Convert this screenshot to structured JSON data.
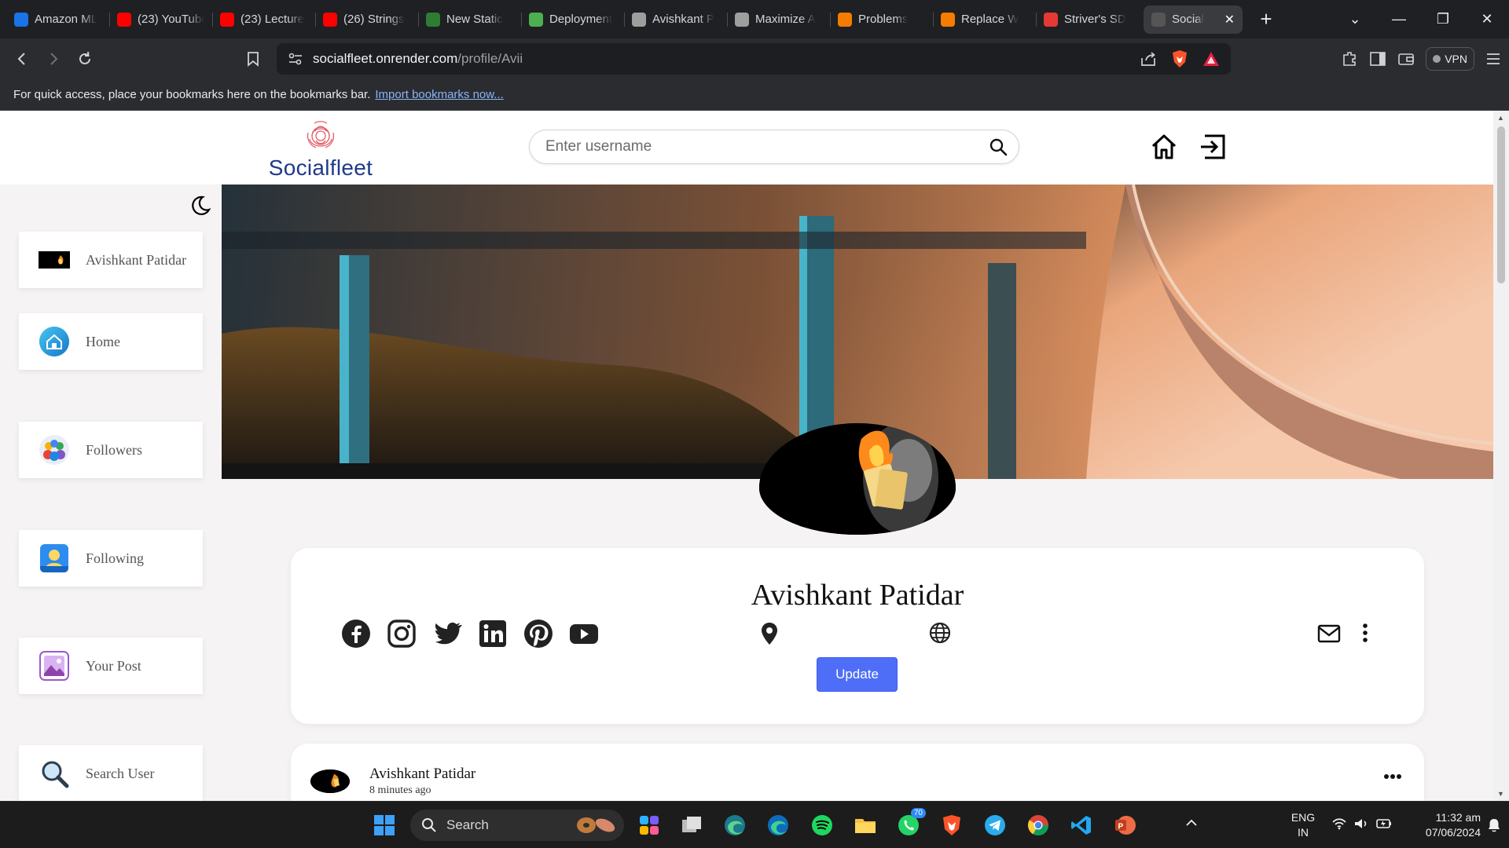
{
  "browser": {
    "tabs": [
      {
        "label": "Amazon ML",
        "color": "#1a73e8"
      },
      {
        "label": "(23) YouTube",
        "color": "#ff0000"
      },
      {
        "label": "(23) Lecture",
        "color": "#ff0000"
      },
      {
        "label": "(26) Strings",
        "color": "#ff0000"
      },
      {
        "label": "New Static",
        "color": "#2e7d32"
      },
      {
        "label": "Deployment",
        "color": "#4caf50"
      },
      {
        "label": "Avishkant P",
        "color": "#9e9e9e"
      },
      {
        "label": "Maximize A",
        "color": "#9e9e9e"
      },
      {
        "label": "Problems",
        "color": "#f57c00"
      },
      {
        "label": "Replace W",
        "color": "#f57c00"
      },
      {
        "label": "Striver's SD",
        "color": "#e53935"
      },
      {
        "label": "Social",
        "color": "#555555",
        "active": true
      }
    ],
    "url_host": "socialfleet.onrender.com",
    "url_path": "/profile/Avii",
    "vpn_label": "VPN",
    "bookmarks_text": "For quick access, place your bookmarks here on the bookmarks bar.",
    "bookmarks_link": "Import bookmarks now..."
  },
  "site": {
    "brand": "Socialfleet",
    "search_placeholder": "Enter username",
    "accent_color": "#4f6ef7"
  },
  "sidebar": {
    "items": [
      {
        "label": "Avishkant Patidar",
        "icon": "user-avatar"
      },
      {
        "label": "Home",
        "icon": "home-icon"
      },
      {
        "label": "Followers",
        "icon": "followers-icon"
      },
      {
        "label": "Following",
        "icon": "following-icon"
      },
      {
        "label": "Your Post",
        "icon": "image-icon"
      },
      {
        "label": "Search User",
        "icon": "search-icon"
      }
    ]
  },
  "profile": {
    "name": "Avishkant Patidar",
    "update_label": "Update",
    "socials": [
      "facebook-icon",
      "instagram-icon",
      "twitter-icon",
      "linkedin-icon",
      "pinterest-icon",
      "youtube-icon"
    ]
  },
  "post": {
    "author": "Avishkant Patidar",
    "time": "8 minutes ago"
  },
  "taskbar": {
    "search_label": "Search",
    "whatsapp_badge": "70",
    "lang_1": "ENG",
    "lang_2": "IN",
    "time": "11:32 am",
    "date": "07/06/2024"
  }
}
